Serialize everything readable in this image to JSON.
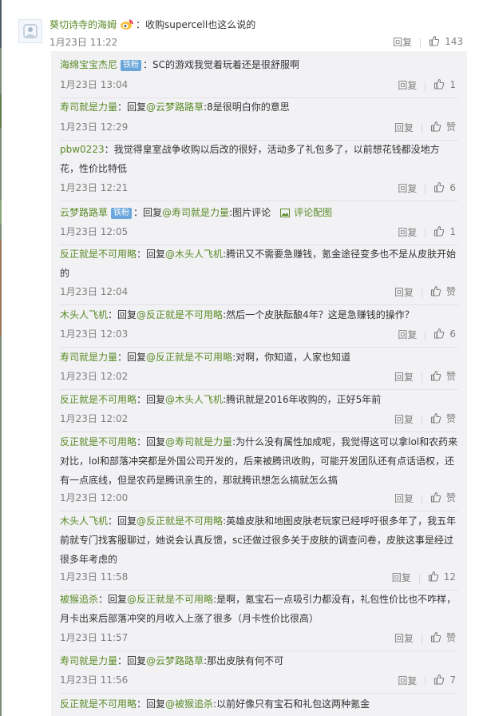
{
  "main_comment": {
    "user": "葵切诗寺的海姆",
    "text": "：收购supercell也这么说的",
    "time": "1月23日 11:22",
    "reply_label": "回复",
    "likes": "143"
  },
  "badge_label": "铁粉",
  "image_link": "评论配图",
  "reply_label": "回复",
  "replies": [
    {
      "user": "海绵宝宝杰尼",
      "badge": true,
      "sep": "：",
      "reply_word": "",
      "target": "",
      "text": "SC的游戏我觉着玩着还是很舒服啊",
      "time": "1月23日 13:04",
      "likes": "1"
    },
    {
      "user": "寿司就是力量",
      "badge": false,
      "sep": "：",
      "reply_word": "回复",
      "target": "@云梦路路草",
      "text": ":8是很明白你的意思",
      "time": "1月23日 12:29",
      "likes": "赞"
    },
    {
      "user": "pbw0223",
      "badge": false,
      "sep": "：",
      "reply_word": "",
      "target": "",
      "text": "我觉得皇室战争收购以后改的很好，活动多了礼包多了，以前想花钱都没地方花，性价比特低",
      "time": "1月23日 12:21",
      "likes": "6"
    },
    {
      "user": "云梦路路草",
      "badge": true,
      "sep": "：",
      "reply_word": "回复",
      "target": "@寿司就是力量",
      "text": ":图片评论",
      "image": true,
      "time": "1月23日 12:05",
      "likes": "1"
    },
    {
      "user": "反正就是不可用略",
      "badge": false,
      "sep": "：",
      "reply_word": "回复",
      "target": "@木头人飞机",
      "text": ":腾讯又不需要急赚钱，氪金途径变多也不是从皮肤开始的",
      "time": "1月23日 12:04",
      "likes": "赞"
    },
    {
      "user": "木头人飞机",
      "badge": false,
      "sep": "：",
      "reply_word": "回复",
      "target": "@反正就是不可用略",
      "text": ":然后一个皮肤酝酿4年？这是急赚钱的操作？",
      "time": "1月23日 12:03",
      "likes": "6"
    },
    {
      "user": "寿司就是力量",
      "badge": false,
      "sep": "：",
      "reply_word": "回复",
      "target": "@反正就是不可用略",
      "text": ":对啊，你知道，人家也知道",
      "time": "1月23日 12:02",
      "likes": "赞"
    },
    {
      "user": "反正就是不可用略",
      "badge": false,
      "sep": "：",
      "reply_word": "回复",
      "target": "@木头人飞机",
      "text": ":腾讯就是2016年收购的，正好5年前",
      "time": "1月23日 12:02",
      "likes": "赞"
    },
    {
      "user": "反正就是不可用略",
      "badge": false,
      "sep": "：",
      "reply_word": "回复",
      "target": "@寿司就是力量",
      "text": ":为什么没有属性加成呢，我觉得这可以拿lol和农药来对比，lol和部落冲突都是外国公司开发的，后来被腾讯收购，可能开发团队还有点话语权，还有一点底线，但是农药是腾讯亲生的，那就腾讯想怎么搞就怎么搞",
      "time": "1月23日 12:00",
      "likes": "赞"
    },
    {
      "user": "木头人飞机",
      "badge": false,
      "sep": "：",
      "reply_word": "回复",
      "target": "@反正就是不可用略",
      "text": ":英雄皮肤和地图皮肤老玩家已经呼吁很多年了，我五年前就专门找客服聊过，她说会认真反馈，sc还做过很多关于皮肤的调查问卷，皮肤这事是经过很多年考虑的",
      "time": "1月23日 11:58",
      "likes": "12"
    },
    {
      "user": "被猴追杀",
      "badge": false,
      "sep": "：",
      "reply_word": "回复",
      "target": "@反正就是不可用略",
      "text": ":是啊，氪宝石一点吸引力都没有，礼包性价比也不咋样，月卡出来后部落冲突的月收入上涨了很多（月卡性价比很高）",
      "time": "1月23日 11:57",
      "likes": "赞"
    },
    {
      "user": "寿司就是力量",
      "badge": false,
      "sep": "：",
      "reply_word": "回复",
      "target": "@云梦路路草",
      "text": ":那出皮肤有何不可",
      "time": "1月23日 11:56",
      "likes": "7"
    },
    {
      "user": "反正就是不可用略",
      "badge": false,
      "sep": "：",
      "reply_word": "回复",
      "target": "@被猴追杀",
      "text": ":以前好像只有宝石和礼包这两种氪金",
      "time": "",
      "likes": ""
    }
  ]
}
